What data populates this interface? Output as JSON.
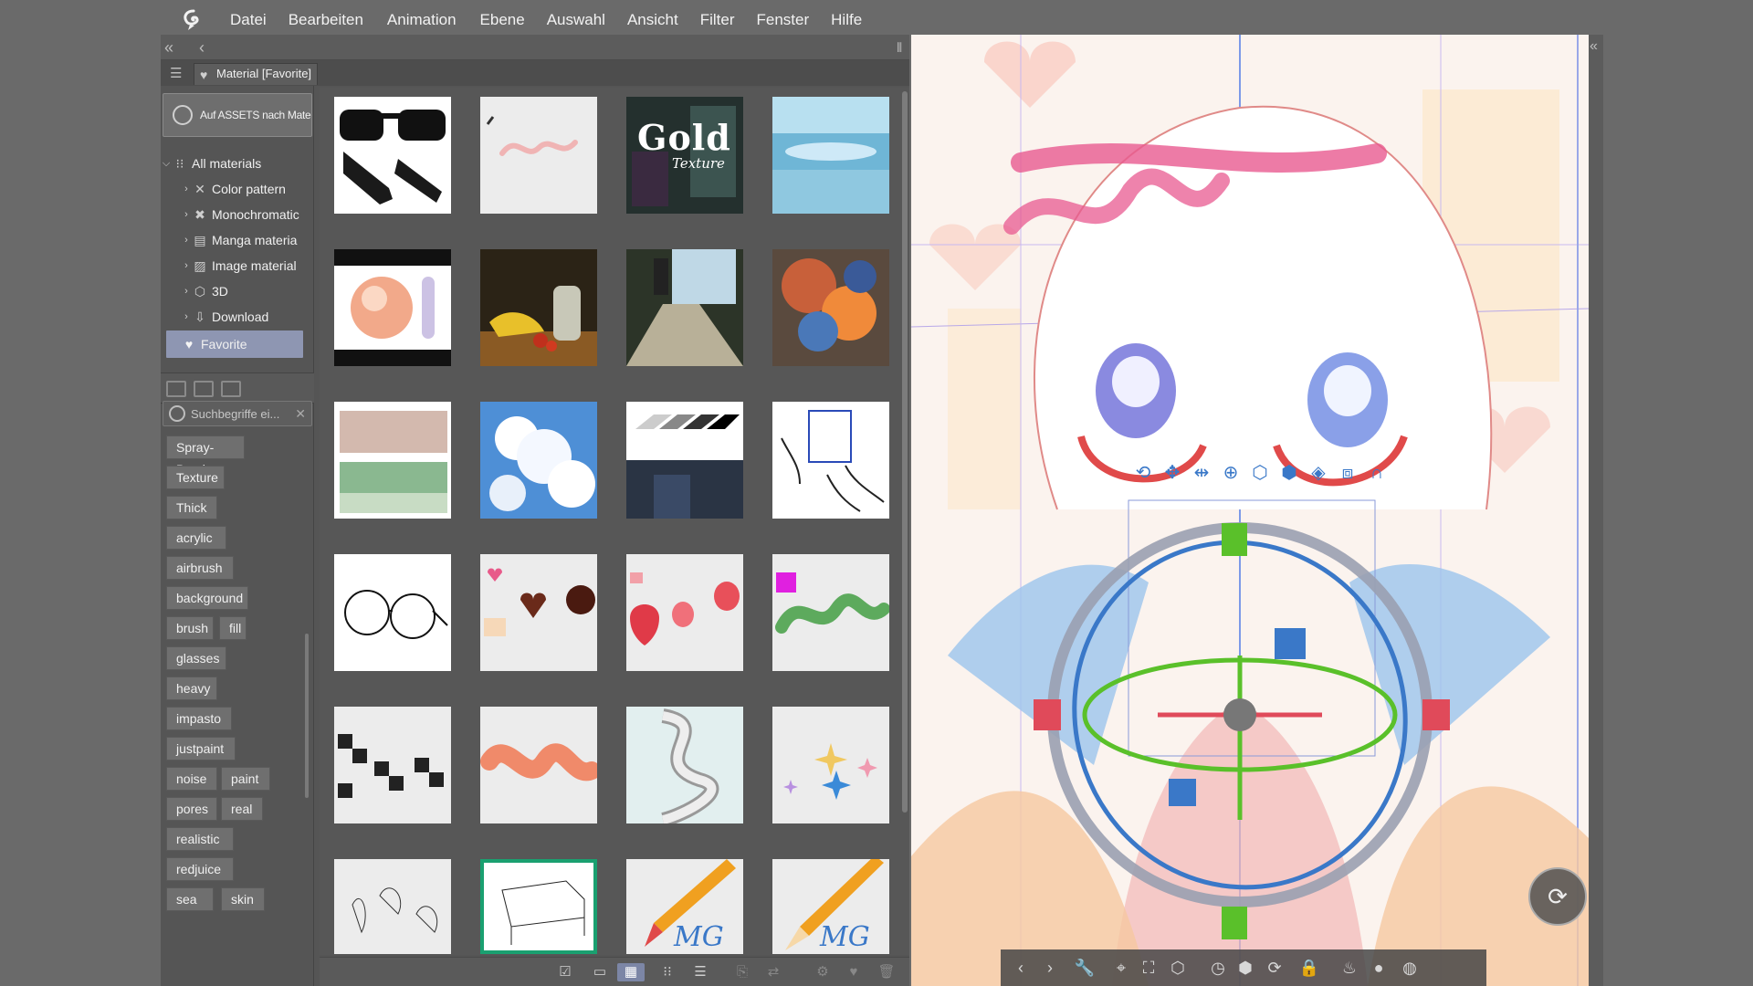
{
  "menubar": {
    "items": [
      "Datei",
      "Bearbeiten",
      "Animation",
      "Ebene",
      "Auswahl",
      "Ansicht",
      "Filter",
      "Fenster",
      "Hilfe"
    ]
  },
  "panel": {
    "tab_label": "Material [Favorite]",
    "assets_button": "Auf ASSETS nach Materi",
    "tree": [
      {
        "label": "All materials",
        "icon": "grid-icon"
      },
      {
        "label": "Color pattern",
        "icon": "color-pattern-icon"
      },
      {
        "label": "Monochromatic",
        "icon": "monochromatic-icon"
      },
      {
        "label": "Manga materia",
        "icon": "manga-icon"
      },
      {
        "label": "Image material",
        "icon": "image-icon"
      },
      {
        "label": "3D",
        "icon": "cube-icon"
      },
      {
        "label": "Download",
        "icon": "download-icon"
      },
      {
        "label": "Favorite",
        "icon": "heart-icon"
      }
    ],
    "search_placeholder": "Suchbegriffe ei...",
    "tags": [
      "Spray-Brush",
      "Texture",
      "Thick",
      "acrylic",
      "airbrush",
      "background",
      "brush",
      "fill",
      "glasses",
      "heavy",
      "impasto",
      "justpaint",
      "noise",
      "paint",
      "pores",
      "real",
      "realistic",
      "redjuice",
      "sea",
      "skin"
    ]
  },
  "thumbnails": {
    "gold_title": "Gold",
    "gold_subtitle": "Texture",
    "pencil_text": "MG"
  },
  "colors": {
    "accent": "#8e96b2",
    "panel_bg": "#555555",
    "canvas_bg": "#fbf6f2"
  }
}
